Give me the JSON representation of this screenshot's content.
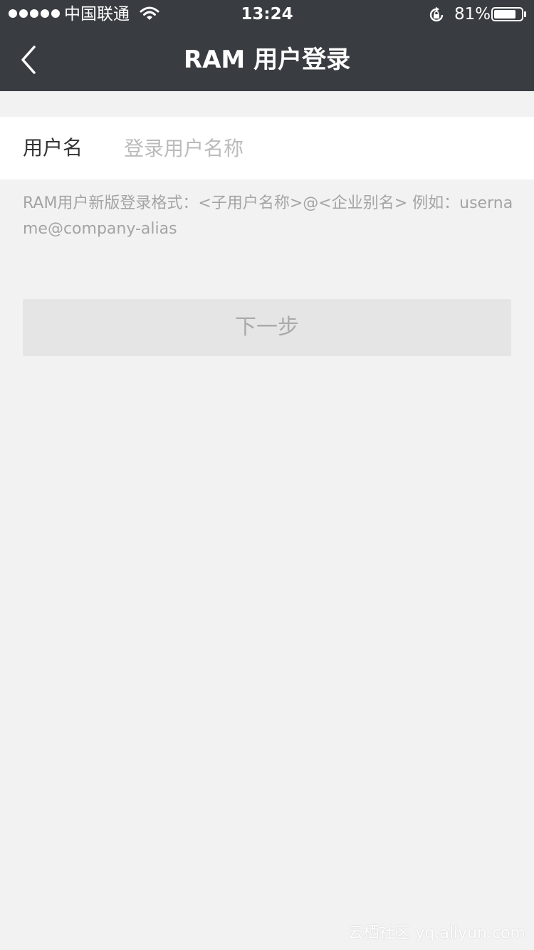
{
  "status_bar": {
    "carrier": "中国联通",
    "time": "13:24",
    "battery_percent": "81%",
    "battery_level": 0.81,
    "icons": [
      "signal-dots",
      "wifi-icon",
      "rotation-lock-icon",
      "battery-icon"
    ]
  },
  "nav": {
    "title": "RAM 用户登录",
    "back_icon": "chevron-left-icon"
  },
  "form": {
    "username_label": "用户名",
    "username_value": "",
    "username_placeholder": "登录用户名称"
  },
  "hint": "RAM用户新版登录格式：<子用户名称>@<企业别名> 例如：username@company-alias",
  "next_button_label": "下一步",
  "watermark": "云栖社区 yq.aliyun.com",
  "colors": {
    "header_bg": "#393c40",
    "page_bg": "#f2f2f2",
    "button_disabled_bg": "#e5e5e5"
  }
}
